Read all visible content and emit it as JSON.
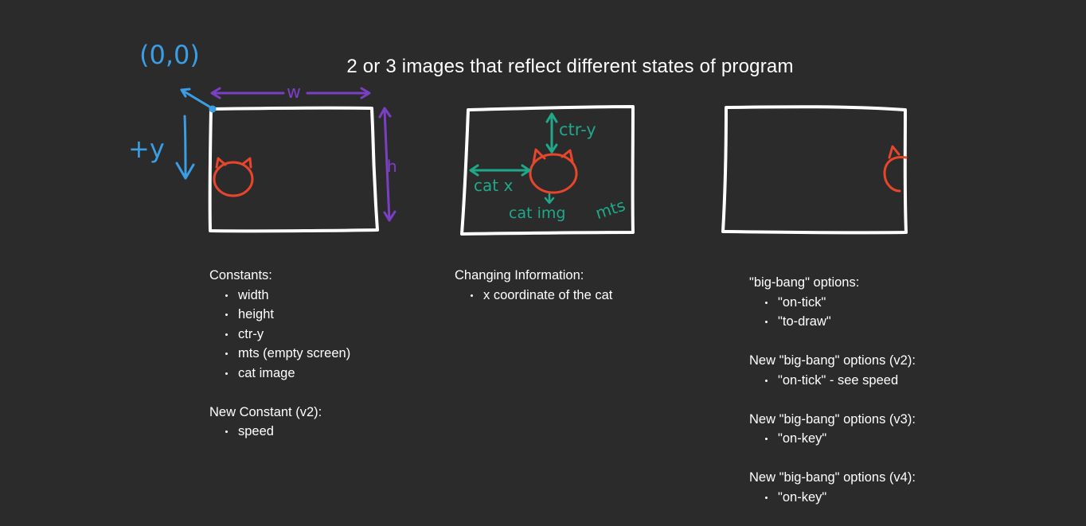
{
  "title": "2 or 3 images that reflect different states of program",
  "colors": {
    "background": "#2b2b2b",
    "frame": "#ffffff",
    "origin": "#3a9ee4",
    "dimension": "#7b3fc4",
    "cat": "#e8462c",
    "annotation": "#1fa88a"
  },
  "annotations": {
    "origin": "(0,0)",
    "plus_y": "+y",
    "width": "w",
    "height": "h",
    "ctr_y": "ctr-y",
    "cat_x": "cat x",
    "cat_img": "cat img",
    "mts": "mts"
  },
  "constants": {
    "heading": "Constants:",
    "items": [
      "width",
      "height",
      "ctr-y",
      "mts (empty screen)",
      "cat image"
    ],
    "v2_heading": "New Constant (v2):",
    "v2_items": [
      "speed"
    ]
  },
  "changing": {
    "heading": "Changing Information:",
    "items": [
      "x coordinate of the cat"
    ]
  },
  "bigbang": {
    "heading": "\"big-bang\" options:",
    "items": [
      "\"on-tick\"",
      "\"to-draw\""
    ],
    "v2_heading": "New \"big-bang\" options (v2):",
    "v2_items": [
      "\"on-tick\" - see speed"
    ],
    "v3_heading": "New \"big-bang\" options (v3):",
    "v3_items": [
      "\"on-key\""
    ],
    "v4_heading": "New \"big-bang\" options (v4):",
    "v4_items": [
      "\"on-key\""
    ]
  }
}
